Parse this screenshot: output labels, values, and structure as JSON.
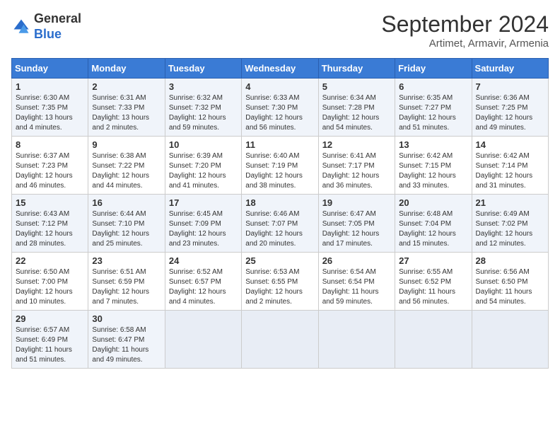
{
  "logo": {
    "general": "General",
    "blue": "Blue"
  },
  "title": "September 2024",
  "subtitle": "Artimet, Armavir, Armenia",
  "headers": [
    "Sunday",
    "Monday",
    "Tuesday",
    "Wednesday",
    "Thursday",
    "Friday",
    "Saturday"
  ],
  "weeks": [
    [
      {
        "day": "1",
        "rise": "6:30 AM",
        "set": "7:35 PM",
        "daylight": "13 hours and 4 minutes."
      },
      {
        "day": "2",
        "rise": "6:31 AM",
        "set": "7:33 PM",
        "daylight": "13 hours and 2 minutes."
      },
      {
        "day": "3",
        "rise": "6:32 AM",
        "set": "7:32 PM",
        "daylight": "12 hours and 59 minutes."
      },
      {
        "day": "4",
        "rise": "6:33 AM",
        "set": "7:30 PM",
        "daylight": "12 hours and 56 minutes."
      },
      {
        "day": "5",
        "rise": "6:34 AM",
        "set": "7:28 PM",
        "daylight": "12 hours and 54 minutes."
      },
      {
        "day": "6",
        "rise": "6:35 AM",
        "set": "7:27 PM",
        "daylight": "12 hours and 51 minutes."
      },
      {
        "day": "7",
        "rise": "6:36 AM",
        "set": "7:25 PM",
        "daylight": "12 hours and 49 minutes."
      }
    ],
    [
      {
        "day": "8",
        "rise": "6:37 AM",
        "set": "7:23 PM",
        "daylight": "12 hours and 46 minutes."
      },
      {
        "day": "9",
        "rise": "6:38 AM",
        "set": "7:22 PM",
        "daylight": "12 hours and 44 minutes."
      },
      {
        "day": "10",
        "rise": "6:39 AM",
        "set": "7:20 PM",
        "daylight": "12 hours and 41 minutes."
      },
      {
        "day": "11",
        "rise": "6:40 AM",
        "set": "7:19 PM",
        "daylight": "12 hours and 38 minutes."
      },
      {
        "day": "12",
        "rise": "6:41 AM",
        "set": "7:17 PM",
        "daylight": "12 hours and 36 minutes."
      },
      {
        "day": "13",
        "rise": "6:42 AM",
        "set": "7:15 PM",
        "daylight": "12 hours and 33 minutes."
      },
      {
        "day": "14",
        "rise": "6:42 AM",
        "set": "7:14 PM",
        "daylight": "12 hours and 31 minutes."
      }
    ],
    [
      {
        "day": "15",
        "rise": "6:43 AM",
        "set": "7:12 PM",
        "daylight": "12 hours and 28 minutes."
      },
      {
        "day": "16",
        "rise": "6:44 AM",
        "set": "7:10 PM",
        "daylight": "12 hours and 25 minutes."
      },
      {
        "day": "17",
        "rise": "6:45 AM",
        "set": "7:09 PM",
        "daylight": "12 hours and 23 minutes."
      },
      {
        "day": "18",
        "rise": "6:46 AM",
        "set": "7:07 PM",
        "daylight": "12 hours and 20 minutes."
      },
      {
        "day": "19",
        "rise": "6:47 AM",
        "set": "7:05 PM",
        "daylight": "12 hours and 17 minutes."
      },
      {
        "day": "20",
        "rise": "6:48 AM",
        "set": "7:04 PM",
        "daylight": "12 hours and 15 minutes."
      },
      {
        "day": "21",
        "rise": "6:49 AM",
        "set": "7:02 PM",
        "daylight": "12 hours and 12 minutes."
      }
    ],
    [
      {
        "day": "22",
        "rise": "6:50 AM",
        "set": "7:00 PM",
        "daylight": "12 hours and 10 minutes."
      },
      {
        "day": "23",
        "rise": "6:51 AM",
        "set": "6:59 PM",
        "daylight": "12 hours and 7 minutes."
      },
      {
        "day": "24",
        "rise": "6:52 AM",
        "set": "6:57 PM",
        "daylight": "12 hours and 4 minutes."
      },
      {
        "day": "25",
        "rise": "6:53 AM",
        "set": "6:55 PM",
        "daylight": "12 hours and 2 minutes."
      },
      {
        "day": "26",
        "rise": "6:54 AM",
        "set": "6:54 PM",
        "daylight": "11 hours and 59 minutes."
      },
      {
        "day": "27",
        "rise": "6:55 AM",
        "set": "6:52 PM",
        "daylight": "11 hours and 56 minutes."
      },
      {
        "day": "28",
        "rise": "6:56 AM",
        "set": "6:50 PM",
        "daylight": "11 hours and 54 minutes."
      }
    ],
    [
      {
        "day": "29",
        "rise": "6:57 AM",
        "set": "6:49 PM",
        "daylight": "11 hours and 51 minutes."
      },
      {
        "day": "30",
        "rise": "6:58 AM",
        "set": "6:47 PM",
        "daylight": "11 hours and 49 minutes."
      },
      null,
      null,
      null,
      null,
      null
    ]
  ]
}
